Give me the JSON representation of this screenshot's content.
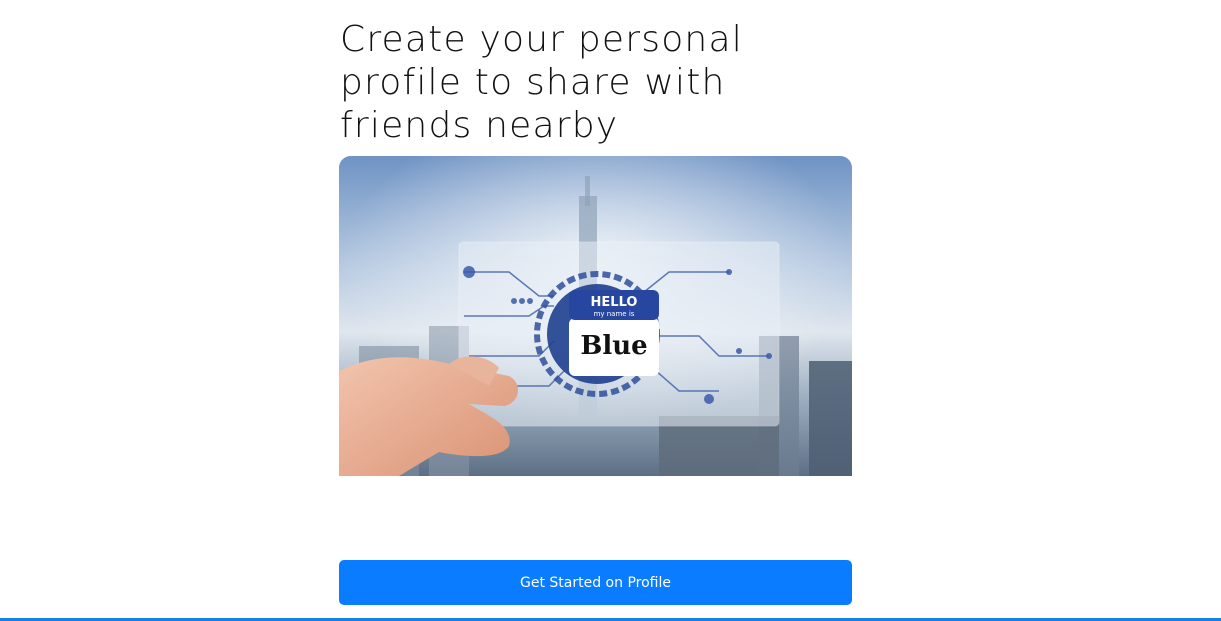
{
  "headline": "Create your personal profile to share with friends nearby",
  "hero": {
    "badge_title": "HELLO",
    "badge_subtitle": "my name is",
    "badge_name": "Blue"
  },
  "cta": {
    "label": "Get Started on Profile",
    "color": "#0a7cff"
  },
  "accent_bar_color": "#1b7fe0"
}
